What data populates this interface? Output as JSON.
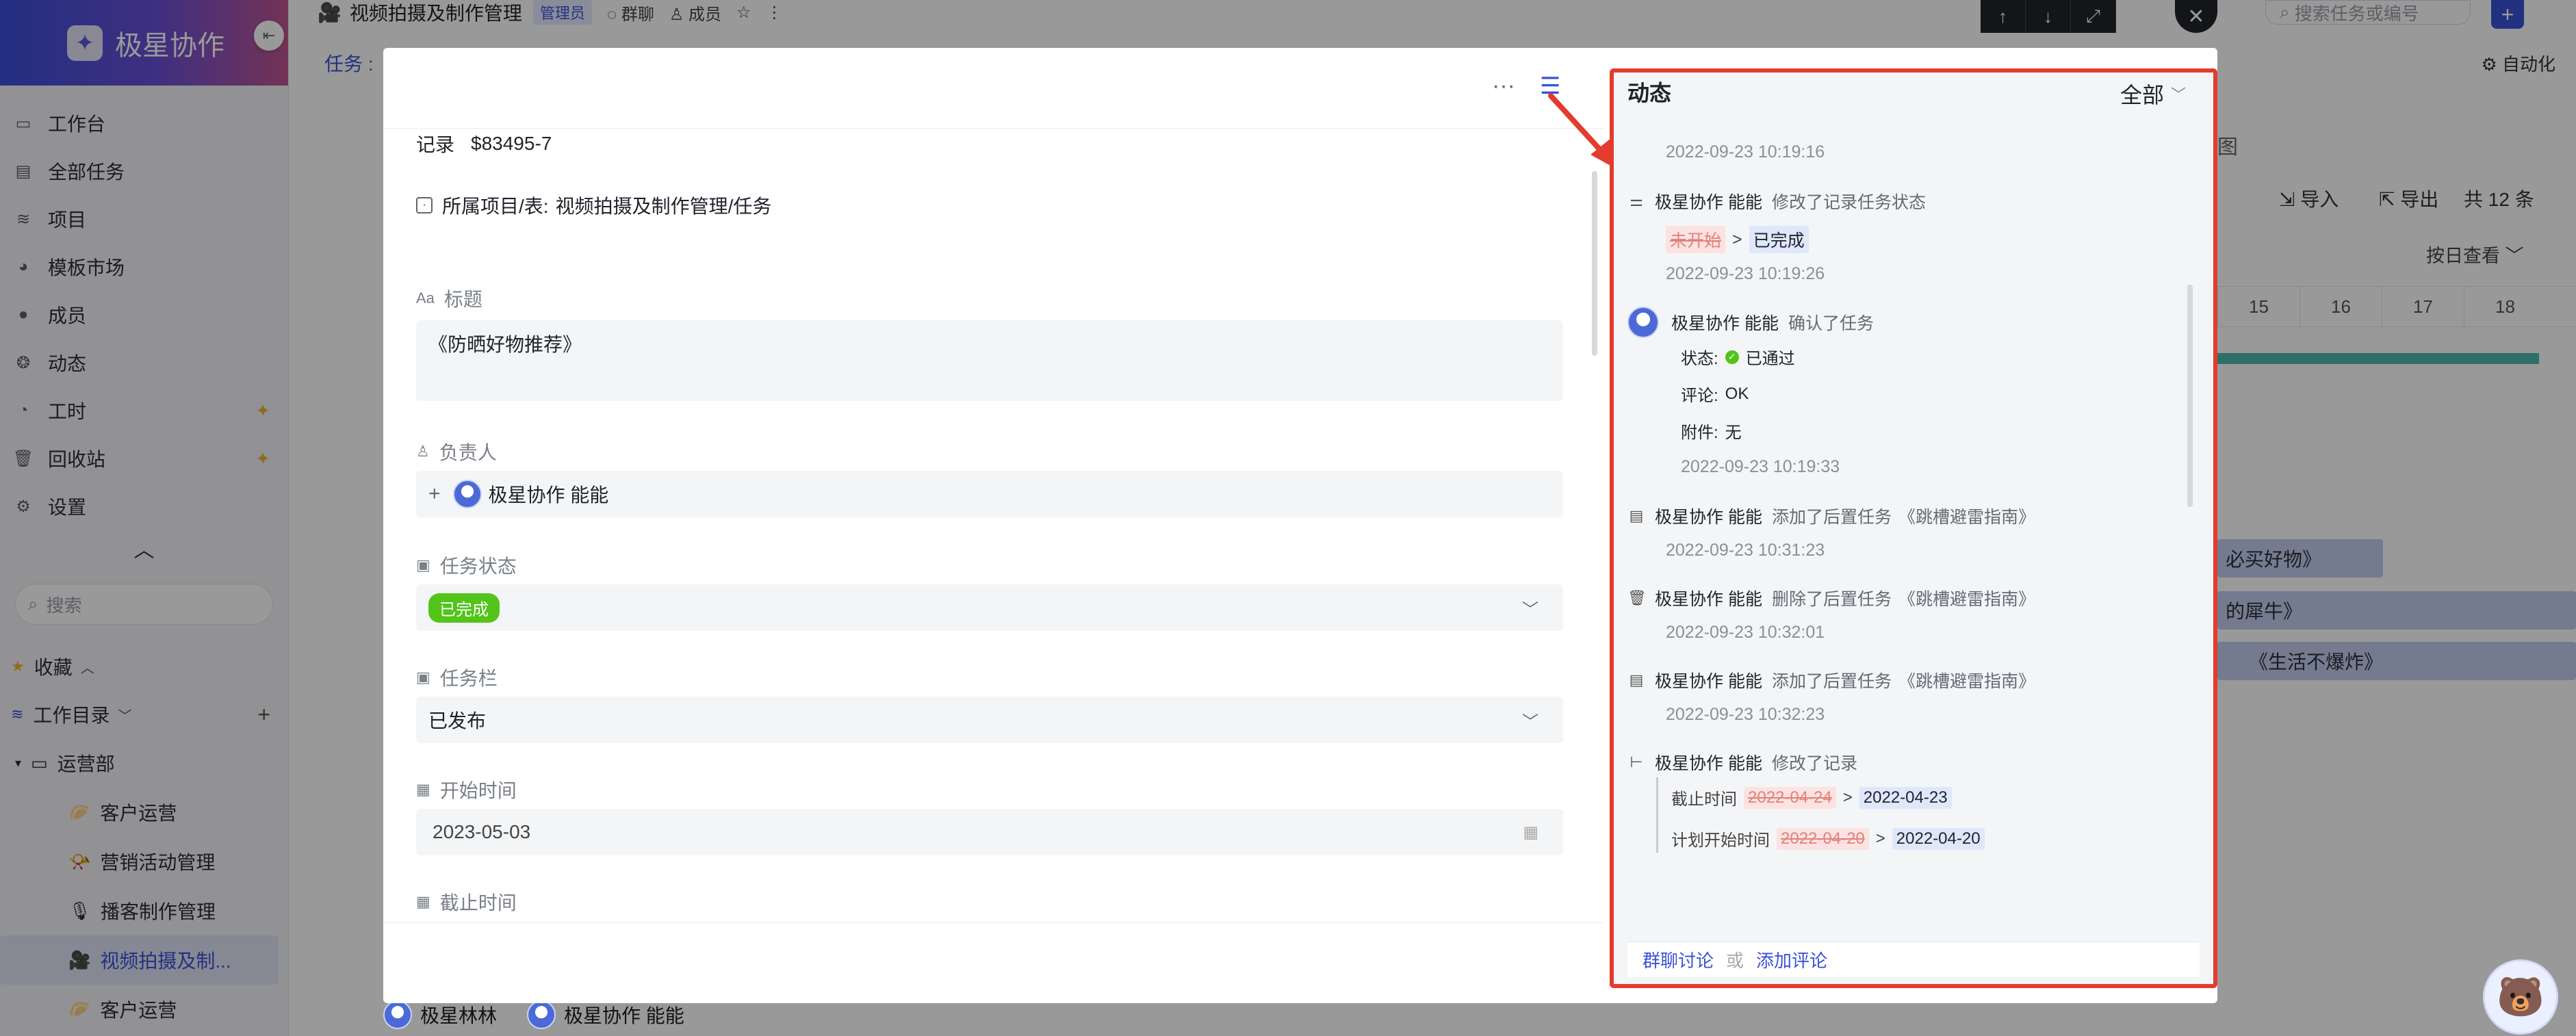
{
  "sidebar": {
    "brand": "极星协作",
    "nav": [
      {
        "label": "工作台",
        "icon": "monitor-icon"
      },
      {
        "label": "全部任务",
        "icon": "task-list-icon"
      },
      {
        "label": "项目",
        "icon": "layers-icon"
      },
      {
        "label": "模板市场",
        "icon": "template-icon"
      },
      {
        "label": "成员",
        "icon": "user-icon"
      },
      {
        "label": "动态",
        "icon": "activity-icon"
      },
      {
        "label": "工时",
        "icon": "clock-icon"
      },
      {
        "label": "回收站",
        "icon": "trash-icon"
      },
      {
        "label": "设置",
        "icon": "gear-icon"
      }
    ],
    "search_placeholder": "搜索",
    "favorites": "收藏",
    "workspace": "工作目录",
    "folder": "运营部",
    "items": [
      "客户运营",
      "营销活动管理",
      "播客制作管理",
      "视频拍摄及制...",
      "客户运营"
    ]
  },
  "topbar": {
    "title": "视频拍摄及制作管理",
    "role_badge": "管理员",
    "group_chat": "群聊",
    "members": "成员",
    "tab": "任务",
    "search_placeholder": "搜索任务或编号",
    "automate": "自动化"
  },
  "background": {
    "import": "导入",
    "export": "导出",
    "total": "共 12 条",
    "view_by": "按日查看",
    "view_label": "图",
    "days": [
      "15",
      "16",
      "17",
      "18"
    ],
    "bars": [
      "必买好物》",
      "的犀牛》",
      "《生活不爆炸》"
    ],
    "people": [
      "极星林林",
      "极星协作 能能"
    ]
  },
  "detail": {
    "record_label": "记录",
    "record_id": "$83495-7",
    "project_label": "所属项目/表:",
    "project_value": "视频拍摄及制作管理/任务",
    "title_label": "标题",
    "title_value": "《防晒好物推荐》",
    "assignee_label": "负责人",
    "assignee": "极星协作 能能",
    "status_label": "任务状态",
    "status_value": "已完成",
    "column_label": "任务栏",
    "column_value": "已发布",
    "start_label": "开始时间",
    "start_value": "2023-05-03",
    "due_label": "截止时间"
  },
  "activity": {
    "title": "动态",
    "filter": "全部",
    "top_time": "2022-09-23 10:19:16",
    "entries": [
      {
        "user": "极星协作 能能",
        "action": "修改了记录任务状态",
        "old": "未开始",
        "new": "已完成",
        "time": "2022-09-23 10:19:26"
      },
      {
        "user": "极星协作 能能",
        "action": "确认了任务",
        "status_k": "状态:",
        "status_v": "已通过",
        "comment_k": "评论:",
        "comment_v": "OK",
        "attach_k": "附件:",
        "attach_v": "无",
        "time": "2022-09-23 10:19:33"
      },
      {
        "user": "极星协作 能能",
        "action": "添加了后置任务",
        "target": "《跳槽避雷指南》",
        "time": "2022-09-23 10:31:23"
      },
      {
        "user": "极星协作 能能",
        "action": "删除了后置任务",
        "target": "《跳槽避雷指南》",
        "time": "2022-09-23 10:32:01"
      },
      {
        "user": "极星协作 能能",
        "action": "添加了后置任务",
        "target": "《跳槽避雷指南》",
        "time": "2022-09-23 10:32:23"
      },
      {
        "user": "极星协作 能能",
        "action": "修改了记录",
        "field1": "截止时间",
        "old1": "2022-04-24",
        "new1": "2022-04-23",
        "field2": "计划开始时间",
        "old2": "2022-04-20",
        "new2": "2022-04-20"
      }
    ],
    "group_chat": "群聊讨论",
    "or": "或",
    "add_comment": "添加评论"
  }
}
